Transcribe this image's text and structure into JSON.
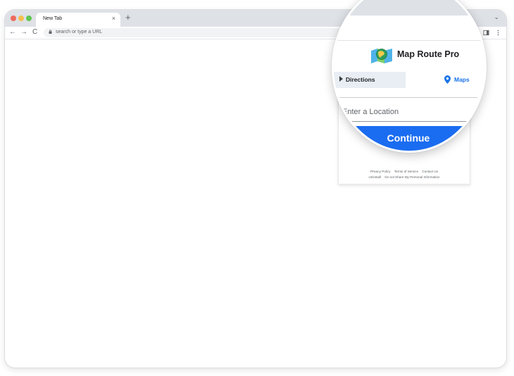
{
  "browser": {
    "tab_title": "New Tab",
    "tab_close": "×",
    "new_tab": "+",
    "tabbar_chevron": "⌄",
    "omnibox_placeholder": "search or type a URL",
    "nav": {
      "back": "←",
      "forward": "→",
      "reload": "C"
    }
  },
  "extension": {
    "name": "Map Route Pro",
    "tabs": {
      "directions": "Directions",
      "maps": "Maps"
    },
    "location_placeholder": "Enter a Location",
    "continue_label": "Continue",
    "footer": {
      "privacy_policy": "Privacy Policy",
      "terms_of_service": "Terms of Service",
      "contact_us": "Contact Us",
      "uninstall": "Uninstall",
      "do_not_share": "Do not Share My Personal Information"
    }
  },
  "colors": {
    "accent_blue": "#1a73e8",
    "button_blue": "#1a6cf0",
    "tab_bar": "#dee1e6",
    "directions_tab_bg": "#e8eef3"
  },
  "icons": {
    "lock": "lock-icon",
    "share": "share-icon",
    "extensions": "puzzle-icon",
    "side_panel": "side-panel-icon",
    "menu": "kebab-menu-icon",
    "logo": "map-globe-logo-icon",
    "directions_chevron": "chevron-right-icon",
    "maps_pin": "map-pin-icon"
  }
}
